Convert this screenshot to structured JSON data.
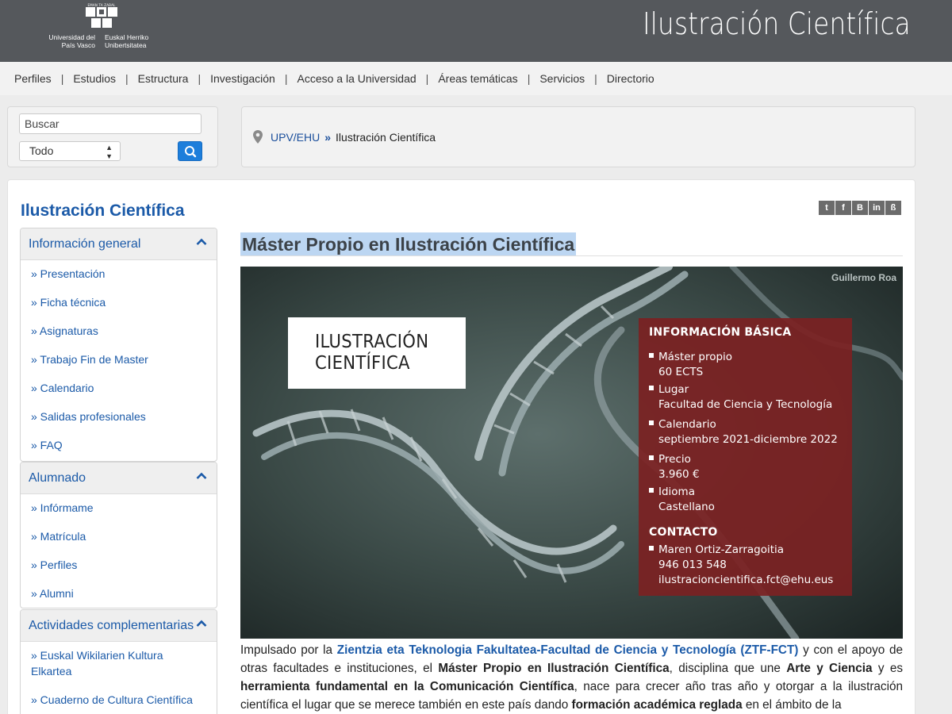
{
  "header": {
    "site_title": "Ilustración Científica",
    "logo": {
      "motto": "EMAN TA ZABAL ZAZU",
      "name_es": "Universidad del País Vasco",
      "name_eu": "Euskal Herriko Unibertsitatea"
    }
  },
  "topnav": [
    "Perfiles",
    "Estudios",
    "Estructura",
    "Investigación",
    "Acceso a la Universidad",
    "Áreas temáticas",
    "Servicios",
    "Directorio"
  ],
  "search": {
    "placeholder": "Buscar",
    "scope": "Todo",
    "button_icon": "search-icon"
  },
  "breadcrumb": {
    "icon": "location-pin-icon",
    "root": "UPV/EHU",
    "current": "Ilustración Científica"
  },
  "sidebar": {
    "title": "Ilustración Científica",
    "sections": [
      {
        "title": "Información general",
        "items": [
          "» Presentación",
          "» Ficha técnica",
          "» Asignaturas",
          "» Trabajo Fin de Master",
          "» Calendario",
          "» Salidas profesionales",
          "» FAQ"
        ]
      },
      {
        "title": "Alumnado",
        "items": [
          "» Infórmame",
          "» Matrícula",
          "» Perfiles",
          "» Alumni"
        ]
      },
      {
        "title": "Actividades complementarias",
        "items": [
          "» Euskal Wikilarien Kultura Elkartea",
          "» Cuaderno de Cultura Científica"
        ]
      }
    ]
  },
  "share": {
    "icons": [
      "twitter-icon",
      "facebook-icon",
      "blogger-icon",
      "linkedin-icon",
      "meneame-icon"
    ],
    "labels": [
      "t",
      "f",
      "B",
      "in",
      "ß"
    ]
  },
  "content": {
    "heading": "Máster Propio en Ilustración Científica",
    "banner": {
      "credit": "Guillermo Roa",
      "card_line1": "ILUSTRACIÓN",
      "card_line2": "CIENTÍFICA",
      "info_title": "INFORMACIÓN BÁSICA",
      "info": [
        {
          "label": "Máster propio",
          "value": "60 ECTS"
        },
        {
          "label": "Lugar",
          "value": "Facultad de Ciencia y Tecnología"
        },
        {
          "label": "Calendario",
          "value": "septiembre 2021-diciembre 2022"
        },
        {
          "label": "Precio",
          "value": "3.960 €"
        },
        {
          "label": "Idioma",
          "value": "Castellano"
        }
      ],
      "contact_title": "CONTACTO",
      "contact": {
        "name": "Maren Ortiz-Zarragoitia",
        "phone": "946 013 548",
        "email": "ilustracioncientifica.fct@ehu.eus"
      }
    },
    "paragraph": {
      "p1": "Impulsado por la ",
      "link": "Zientzia eta Teknologia Fakultatea-Facultad de Ciencia y Tecnología (ZTF-FCT)",
      "p2": " y con el apoyo de otras facultades e instituciones, el ",
      "b1": "Máster Propio en Ilustración Científica",
      "p3": ", disciplina que une ",
      "b2": "Arte y Ciencia",
      "p4": " y es ",
      "b3": "herramienta fundamental en la Comunicación Científica",
      "p5": ",  nace para crecer año tras año y otorgar a la ilustración científica el lugar que se merece también en este país dando ",
      "b4": "formación académica reglada",
      "p6": " en el ámbito de la"
    }
  }
}
